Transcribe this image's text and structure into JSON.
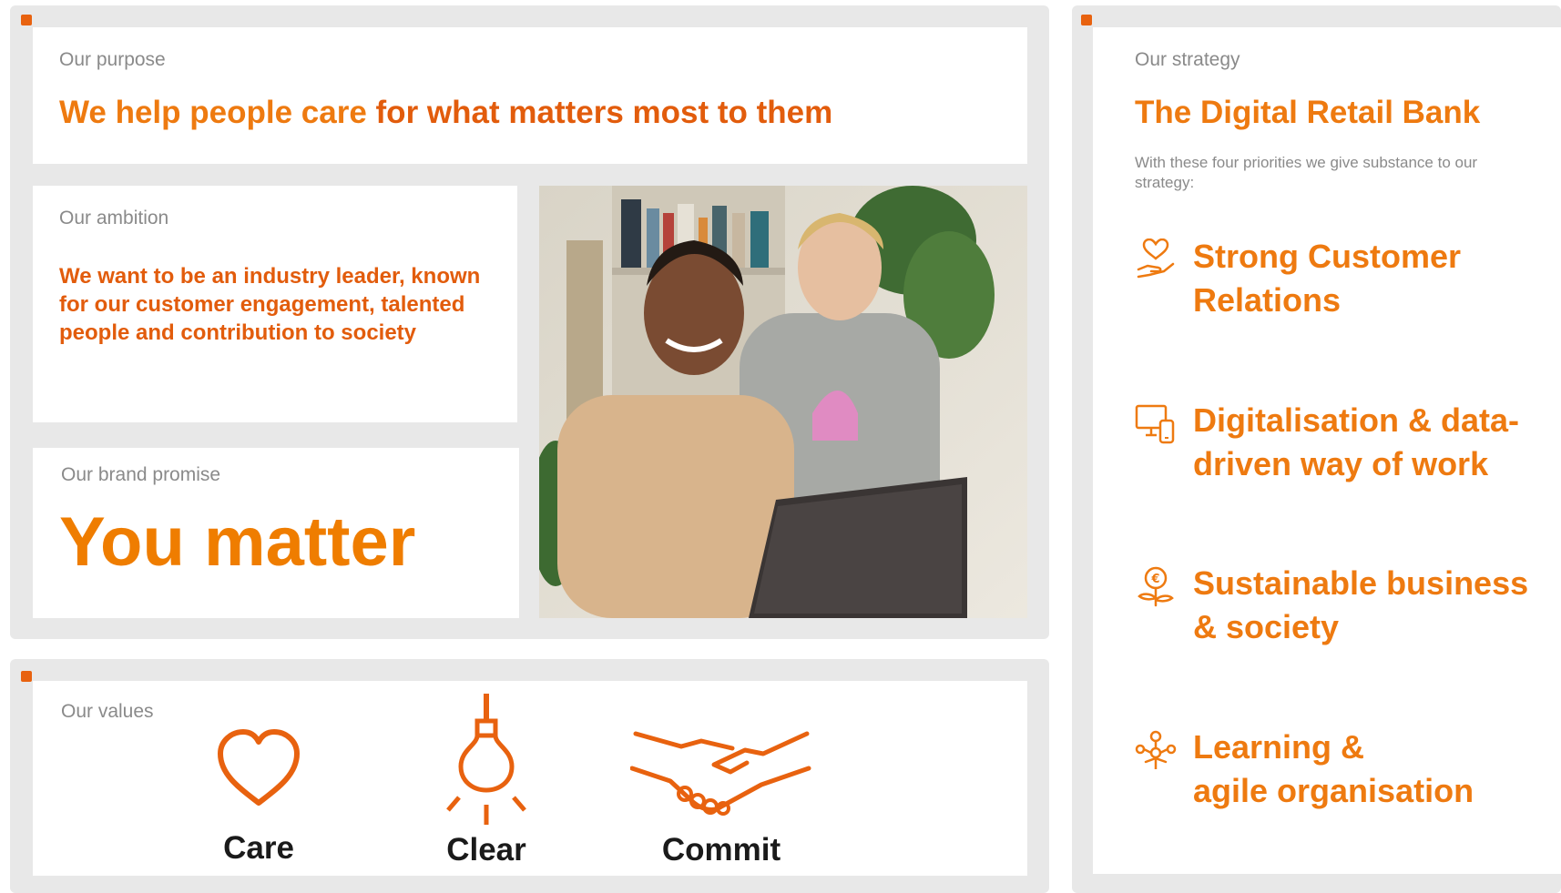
{
  "purpose": {
    "label": "Our purpose",
    "text_part1": "We help people care ",
    "text_part2": "for what matters most to them"
  },
  "ambition": {
    "label": "Our ambition",
    "text": "We want to be an industry leader, known for our customer engagement, talented people and contribution to society"
  },
  "brand_promise": {
    "label": "Our brand promise",
    "text": "You matter"
  },
  "values": {
    "label": "Our values",
    "items": [
      {
        "label": "Care",
        "icon": "heart-icon"
      },
      {
        "label": "Clear",
        "icon": "lightbulb-icon"
      },
      {
        "label": "Commit",
        "icon": "handshake-icon"
      }
    ]
  },
  "strategy": {
    "label": "Our strategy",
    "title": "The Digital Retail Bank",
    "subtitle": "With these four priorities we give substance to our strategy:",
    "items": [
      {
        "line1": "Strong Customer",
        "line2": "Relations",
        "icon": "hand-heart-icon"
      },
      {
        "line1": "Digitalisation & data-",
        "line2": "driven way of work",
        "icon": "devices-icon"
      },
      {
        "line1": "Sustainable business",
        "line2": "& society",
        "icon": "euro-plant-icon"
      },
      {
        "line1": "Learning &",
        "line2": "agile organisation",
        "icon": "people-network-icon"
      }
    ]
  },
  "colors": {
    "accent": "#ee7a10",
    "accent_deep": "#e25c0c",
    "frame": "#e8e8e8",
    "label_gray": "#8a8a8a"
  }
}
